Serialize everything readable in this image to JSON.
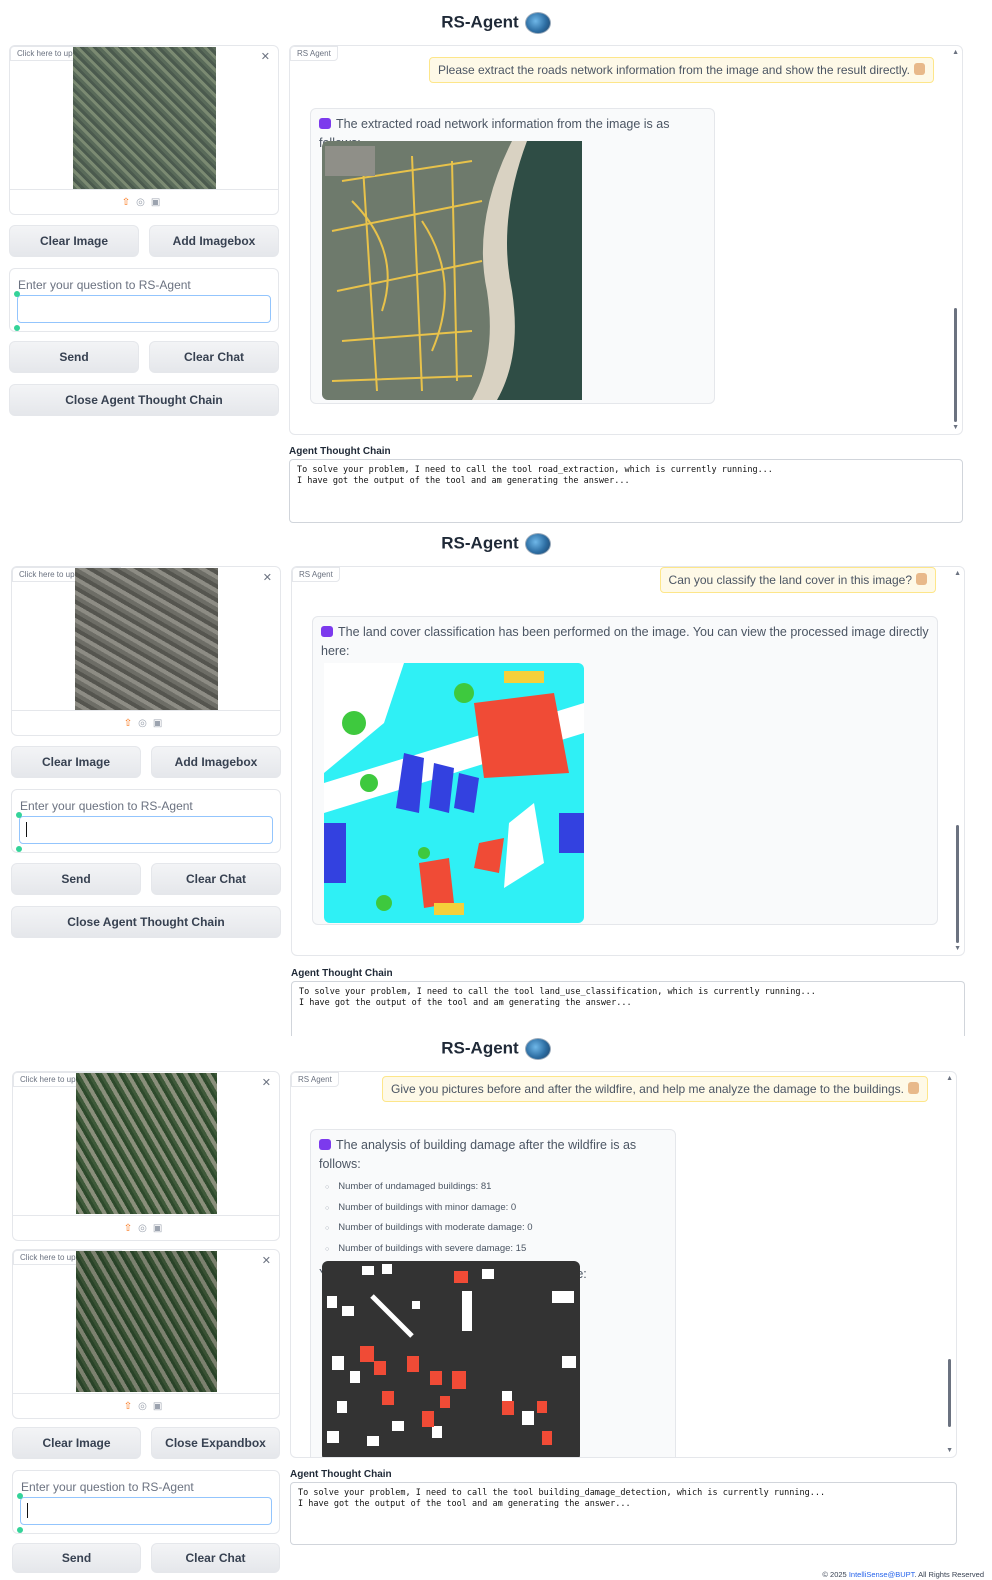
{
  "app_title": "RS-Agent",
  "upload_label": "Click here to upload image",
  "chatbot_label": "RS Agent",
  "question_placeholder": "Enter your question to RS-Agent",
  "thought_chain_label": "Agent Thought Chain",
  "buttons": {
    "clear_image": "Clear Image",
    "add_imagebox": "Add Imagebox",
    "close_expandbox": "Close Expandbox",
    "send": "Send",
    "clear_chat": "Clear Chat",
    "close_thought_chain": "Close Agent Thought Chain"
  },
  "panels": [
    {
      "user_message": "Please extract the roads network information from the image and show the result directly.",
      "bot_message": "The extracted road network information from the image is as follows:",
      "thought_chain": "To solve your problem, I need to call the tool road_extraction, which is currently running...\nI have got the output of the tool and am generating the answer..."
    },
    {
      "user_message": "Can you classify the land cover in this image?",
      "bot_message": "The land cover classification has been performed on the image. You can view the processed image directly here:",
      "thought_chain": "To solve your problem, I need to call the tool land_use_classification, which is currently running...\nI have got the output of the tool and am generating the answer..."
    },
    {
      "user_message": "Give you pictures before and after the wildfire, and help me analyze the damage to the buildings.",
      "bot_message": "The analysis of building damage after the wildfire is as follows:",
      "bullets": [
        "Number of undamaged buildings: 81",
        "Number of buildings with minor damage: 0",
        "Number of buildings with moderate damage: 0",
        "Number of buildings with severe damage: 15"
      ],
      "bot_followup": "You can view the processed image directly here:",
      "thought_chain": "To solve your problem, I need to call the tool building_damage_detection, which is currently running...\nI have got the output of the tool and am generating the answer..."
    }
  ],
  "footer": {
    "prefix": "© 2025 ",
    "link": "IntelliSense@BUPT",
    "suffix": ". All Rights Reserved"
  },
  "colors": {
    "user_bubble": "#fef9e7",
    "input_focus": "#93c5fd",
    "landcover_impervious": "#ffffff",
    "landcover_building": "#3341e0",
    "landcover_low_veg": "#2ff0f5",
    "landcover_tree": "#3ec93e",
    "landcover_car": "#f5d03a",
    "landcover_clutter": "#f04b36",
    "damage_background": "#333333",
    "damage_undamaged": "#ffffff",
    "damage_severe": "#f04b36"
  }
}
